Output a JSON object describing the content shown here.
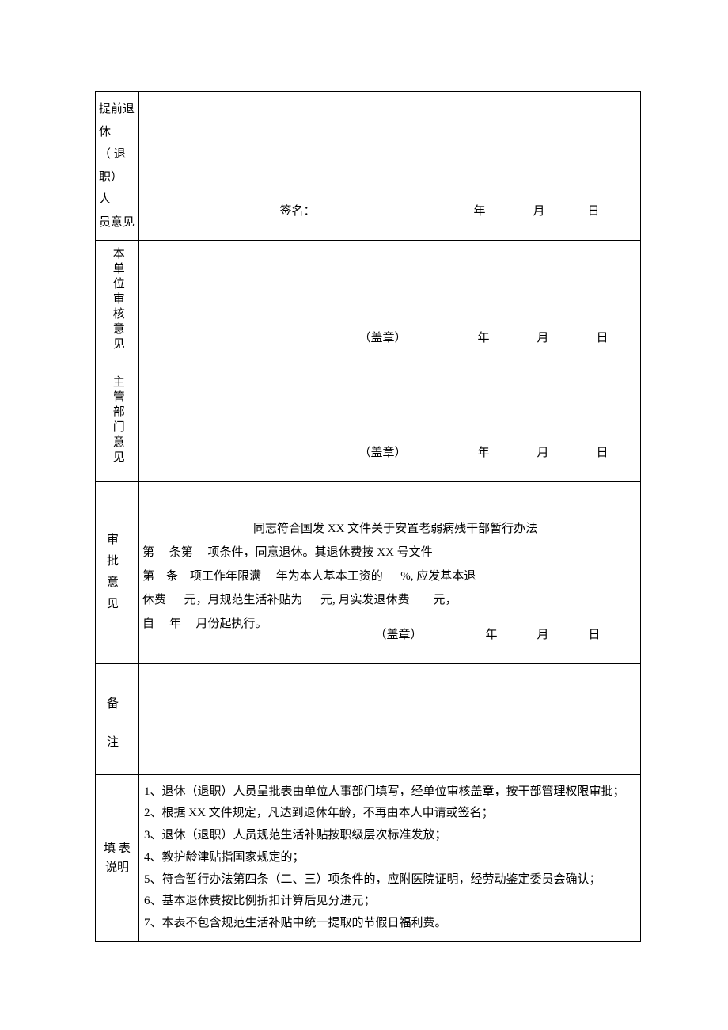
{
  "labels": {
    "personOpinion": "提前退\n休\n （ 退\n职） 人\n员意见",
    "unitReview": "本单位审核意见",
    "deptOpinion": "主管部门意见",
    "approval": [
      "审",
      "批",
      "意",
      "见"
    ],
    "remark": [
      "备",
      "注"
    ],
    "fillNote": "填 表\n说明"
  },
  "sig": {
    "signName": "签名：",
    "sealText": "（盖章）",
    "year": "年",
    "month": "月",
    "day": "日"
  },
  "approval": {
    "l1": "同志符合国发 XX 文件关于安置老弱病残干部暂行办法",
    "l2": "第     条第     项条件，同意退休。其退休费按 XX 号文件",
    "l3": "第    条    项工作年限满     年为本人基本工资的      %, 应发基本退",
    "l4": "休费      元，月规范生活补贴为      元, 月实发退休费        元，",
    "l5": "自     年     月份起执行。"
  },
  "instructions": {
    "i1": "1、退休（退职）人员呈批表由单位人事部门填写，经单位审核盖章，按干部管理权限审批；",
    "i2": "2、根据 XX 文件规定，凡达到退休年龄，不再由本人申请或签名；",
    "i3": "3、退休（退职）人员规范生活补贴按职级层次标准发放；",
    "i4": "4、教护龄津贴指国家规定的；",
    "i5": "5、符合暂行办法第四条（二、三）项条件的，应附医院证明，经劳动鉴定委员会确认；",
    "i6": "6、基本退休费按比例折扣计算后见分进元；",
    "i7": "7、本表不包含规范生活补贴中统一提取的节假日福利费。"
  }
}
